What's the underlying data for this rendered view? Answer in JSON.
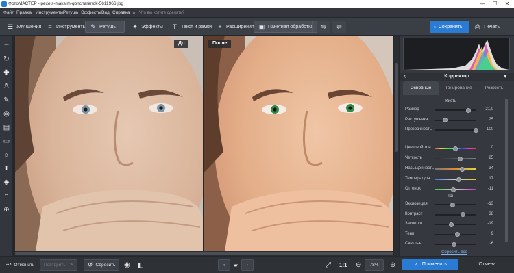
{
  "window": {
    "title": "ФотоМАСТЕР - pexels-maksim-goncharenok-5611966.jpg",
    "controls": [
      "—",
      "☐",
      "✕"
    ]
  },
  "menu": {
    "items": [
      "Файл",
      "Правка",
      "Инструменты",
      "Ретушь",
      "Эффекты",
      "Вид",
      "Справка"
    ],
    "search_placeholder": "Что вы хотите сделать?"
  },
  "toolbar": {
    "tabs": [
      {
        "label": "Улучшения",
        "icon": "sliders-icon"
      },
      {
        "label": "Инструменты",
        "icon": "crop-icon"
      },
      {
        "label": "Ретушь",
        "icon": "brush-icon",
        "active": true
      },
      {
        "label": "Эффекты",
        "icon": "sparkle-icon"
      },
      {
        "label": "Текст и рамки",
        "icon": "text-icon"
      },
      {
        "label": "Расширения",
        "icon": "plus-icon"
      },
      {
        "label": "Пакетная обработка",
        "icon": "images-icon"
      }
    ],
    "save_label": "Сохранить",
    "print_label": "Печать"
  },
  "canvas": {
    "before_label": "До",
    "after_label": "После"
  },
  "panel": {
    "title": "Корректор",
    "tabs": [
      "Основные",
      "Тонирование",
      "Резкость"
    ],
    "active_tab": 0,
    "brush_section": "Кисть",
    "tone_section": "Тон",
    "brush_sliders": [
      {
        "label": "Размер",
        "value": "21,0",
        "level": 0.82
      },
      {
        "label": "Растушевка",
        "value": "25",
        "level": 0.25
      },
      {
        "label": "Прозрачность",
        "value": "100",
        "level": 1.0
      }
    ],
    "color_sliders": [
      {
        "label": "Цветовой тон",
        "value": "0",
        "level": 0.5,
        "gradient": "hue"
      },
      {
        "label": "Четкость",
        "value": "25",
        "level": 0.62,
        "gradient": "gray"
      },
      {
        "label": "Насыщенность",
        "value": "34",
        "level": 0.67,
        "gradient": "sat"
      },
      {
        "label": "Температура",
        "value": "17",
        "level": 0.58,
        "gradient": "temp"
      },
      {
        "label": "Оттенок",
        "value": "-11",
        "level": 0.45,
        "gradient": "tint"
      }
    ],
    "tone_sliders": [
      {
        "label": "Экспозиция",
        "value": "-13",
        "level": 0.44
      },
      {
        "label": "Контраст",
        "value": "38",
        "level": 0.69
      },
      {
        "label": "Засветки",
        "value": "-19",
        "level": 0.4
      },
      {
        "label": "Тени",
        "value": "9",
        "level": 0.55
      },
      {
        "label": "Светлые",
        "value": "-6",
        "level": 0.47
      }
    ],
    "reset_all": "Сбросить все"
  },
  "bottom": {
    "undo": "Отменить",
    "redo": "Повторить",
    "reset": "Сбросить",
    "ratio": "1:1",
    "zoom": "78%",
    "apply": "Применить",
    "cancel": "Отмена"
  },
  "colors": {
    "accent": "#2a7bd4",
    "panel": "#35393f",
    "toolbar": "#3a3e45"
  }
}
